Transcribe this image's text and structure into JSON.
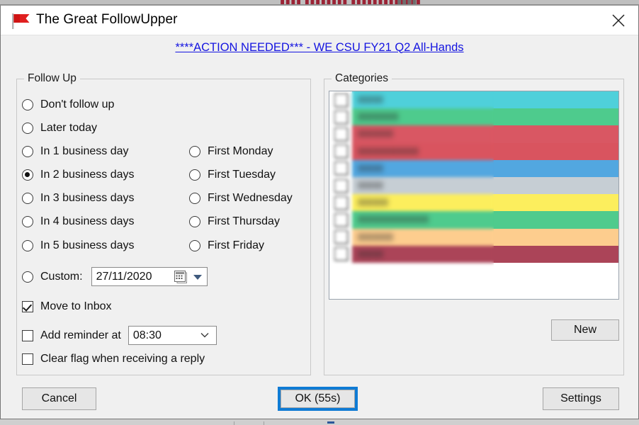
{
  "background_strip": {
    "text_fragment": "▮▮▮▮ ▮▮▮▮▮▮▮▮ ▮▮▮▮▮▮▮▮▮▮▮▮▮",
    "text_fragment2": "▮▮▮▮"
  },
  "window": {
    "title": "The Great FollowUpper",
    "icon": "red-flag-icon",
    "close_label": "✕"
  },
  "subject": {
    "link_text": "****ACTION NEEDED*** - WE CSU FY21 Q2 All-Hands"
  },
  "followup": {
    "group_title": "Follow Up",
    "options_left": [
      {
        "label": "Don't follow up",
        "checked": false
      },
      {
        "label": "Later today",
        "checked": false
      },
      {
        "label": "In 1 business day",
        "checked": false
      },
      {
        "label": "In 2 business days",
        "checked": true
      },
      {
        "label": "In 3 business days",
        "checked": false
      },
      {
        "label": "In 4 business days",
        "checked": false
      },
      {
        "label": "In 5 business days",
        "checked": false
      }
    ],
    "options_right": [
      {
        "label": "First Monday",
        "checked": false
      },
      {
        "label": "First Tuesday",
        "checked": false
      },
      {
        "label": "First Wednesday",
        "checked": false
      },
      {
        "label": "First Thursday",
        "checked": false
      },
      {
        "label": "First Friday",
        "checked": false
      }
    ],
    "custom": {
      "label": "Custom:",
      "checked": false,
      "date_value": "27/11/2020",
      "calendar_icon": "calendar-icon",
      "dropdown_icon": "dropdown-arrow-icon"
    },
    "checkboxes": [
      {
        "label": "Move to Inbox",
        "checked": true
      },
      {
        "label": "Add reminder at",
        "checked": false
      },
      {
        "label": "Clear flag when receiving a reply",
        "checked": false
      }
    ],
    "reminder_time": "08:30"
  },
  "categories": {
    "group_title": "Categories",
    "new_button": "New",
    "rows": [
      {
        "label": "▮▮▮▮▮",
        "color": "#4fd0da",
        "checked": false
      },
      {
        "label": "▮▮▮▮▮▮▮▮",
        "color": "#4ecb8d",
        "checked": false
      },
      {
        "label": "▮▮▮▮▮▮▮",
        "color": "#d95763",
        "checked": false
      },
      {
        "label": "▮▮▮▮▮▮▮▮▮▮▮▮",
        "color": "#d9545f",
        "checked": false
      },
      {
        "label": "▮▮▮▮▮",
        "color": "#52a7e0",
        "checked": false
      },
      {
        "label": "▮▮▮▮▮",
        "color": "#c6ced4",
        "checked": false
      },
      {
        "label": "▮▮▮▮▮▮",
        "color": "#fcee5d",
        "checked": false
      },
      {
        "label": "▮▮▮▮▮▮▮▮▮▮▮▮▮▮",
        "color": "#4fcb8d",
        "checked": false
      },
      {
        "label": "▮▮▮▮▮▮▮",
        "color": "#fdcd8e",
        "checked": false
      },
      {
        "label": "▮▮▮▮▮",
        "color": "#ab4458",
        "checked": false
      }
    ]
  },
  "footer": {
    "cancel_label": "Cancel",
    "ok_label": "OK (55s)",
    "settings_label": "Settings"
  },
  "colors": {
    "accent_focus": "#0f7bd4",
    "link": "#1414e0",
    "flag": "#e02020",
    "dialog_bg": "#f0f0f0"
  }
}
